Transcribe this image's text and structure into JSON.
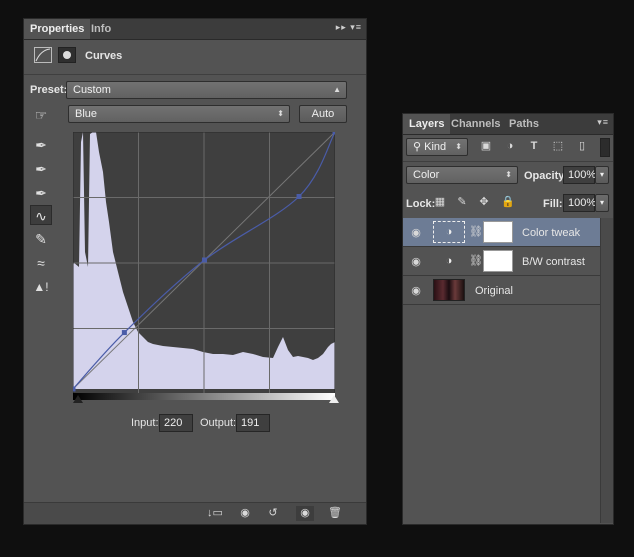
{
  "properties_panel": {
    "tabs": [
      "Properties",
      "Info"
    ],
    "title": "Curves",
    "preset_label": "Preset:",
    "preset_value": "Custom",
    "channel_value": "Blue",
    "auto_label": "Auto",
    "input_label": "Input:",
    "input_value": "220",
    "output_label": "Output:",
    "output_value": "191"
  },
  "layers_panel": {
    "tabs": [
      "Layers",
      "Channels",
      "Paths"
    ],
    "filter_kind": "Kind",
    "blend_mode": "Color",
    "opacity_label": "Opacity:",
    "opacity_value": "100%",
    "lock_label": "Lock:",
    "fill_label": "Fill:",
    "fill_value": "100%",
    "layers": [
      {
        "name": "Color tweak"
      },
      {
        "name": "B/W contrast"
      },
      {
        "name": "Original"
      }
    ]
  },
  "colors": {
    "curve": "#4a5ca8",
    "histogram": "#d4d3ec",
    "selected_layer": "#6d7c95"
  },
  "chart_data": {
    "type": "line",
    "channel": "Blue",
    "curve_points": [
      [
        0,
        0
      ],
      [
        50,
        56
      ],
      [
        128,
        128
      ],
      [
        220,
        191
      ],
      [
        255,
        255
      ]
    ],
    "xlim": [
      0,
      255
    ],
    "ylim": [
      0,
      255
    ],
    "grid": true
  }
}
